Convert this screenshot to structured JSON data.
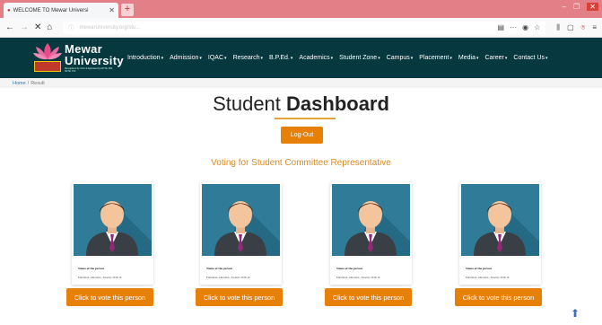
{
  "browser": {
    "tab_title": "WELCOME TO Mewar Universi",
    "tab_close": "✕",
    "new_tab": "+",
    "url": "mewaruniversity.org/stu...",
    "window_controls": {
      "minimize": "–",
      "maximize": "❐",
      "close": "✕"
    }
  },
  "site": {
    "logo_line1": "Mewar",
    "logo_line2": "University",
    "logo_small": "Recognised by UGC & Approved by AICTE, BCI, NCTE, PCI",
    "menu": [
      {
        "label": "Introduction"
      },
      {
        "label": "Admission"
      },
      {
        "label": "IQAC"
      },
      {
        "label": "Research"
      },
      {
        "label": "B.P.Ed."
      },
      {
        "label": "Academics"
      },
      {
        "label": "Student Zone"
      },
      {
        "label": "Campus"
      },
      {
        "label": "Placement"
      },
      {
        "label": "Media"
      },
      {
        "label": "Career"
      },
      {
        "label": "Contact Us"
      }
    ]
  },
  "breadcrumb": {
    "home": "Home",
    "separator": "/",
    "current": "Result"
  },
  "main": {
    "title_part1": "Student ",
    "title_part2": "Dashboard",
    "logout_label": "Log-Out",
    "subtitle": "Voting for Student Committee Representative",
    "candidates": [
      {
        "name": "Name of the person",
        "details": "Education: education , Session: 2018-19",
        "vote_label": "Click to vote this person"
      },
      {
        "name": "Name of the person",
        "details": "Education: education , Session: 2018-19",
        "vote_label": "Click to vote this person"
      },
      {
        "name": "Name of the person",
        "details": "Education: education , Session: 2018-19",
        "vote_label": "Click to vote this person"
      },
      {
        "name": "Name of the person",
        "details": "Education: education , Session: 2018-19",
        "vote_label": "Click to vote this person"
      }
    ]
  },
  "colors": {
    "header_bg": "#05383f",
    "accent": "#e68007",
    "subtitle": "#d98a1f",
    "tabbar": "#e37f86"
  }
}
